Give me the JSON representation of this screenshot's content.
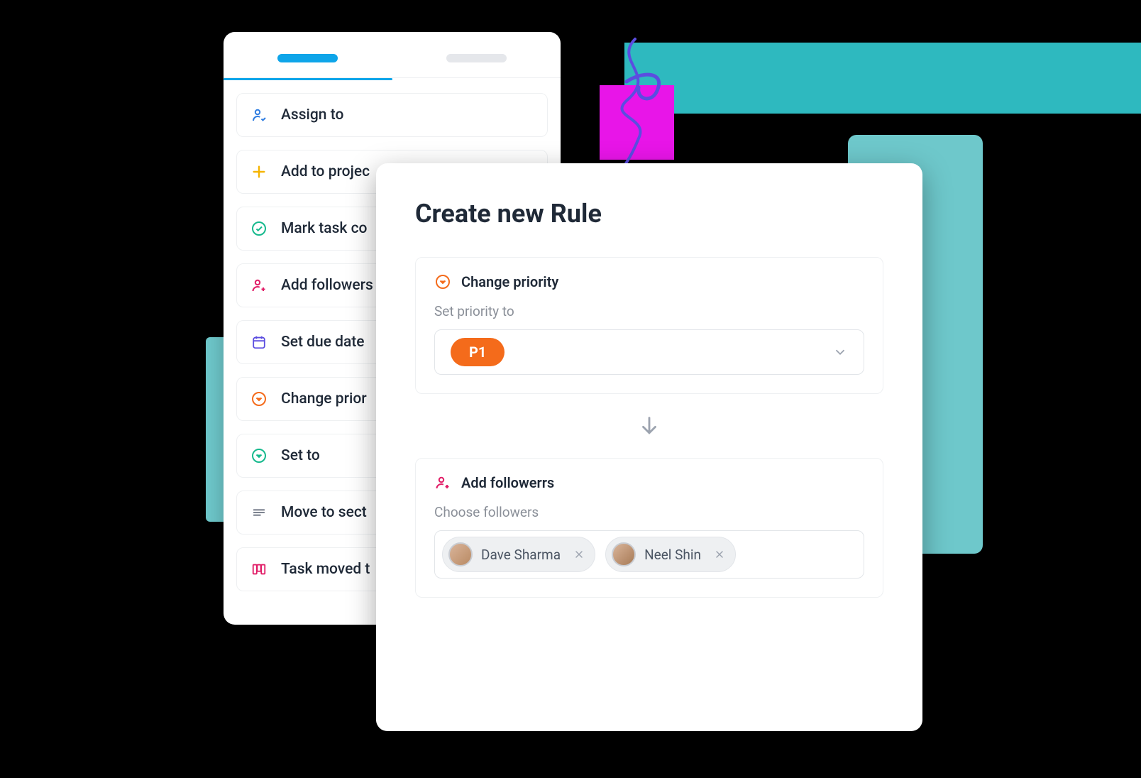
{
  "actions": {
    "items": [
      {
        "label": "Assign to"
      },
      {
        "label": "Add to projec"
      },
      {
        "label": "Mark task co"
      },
      {
        "label": "Add followers"
      },
      {
        "label": "Set due date"
      },
      {
        "label": "Change prior"
      },
      {
        "label": "Set to"
      },
      {
        "label": "Move to sect"
      },
      {
        "label": "Task moved t"
      }
    ]
  },
  "rule": {
    "title": "Create new Rule",
    "priority_block": {
      "title": "Change priority",
      "subtitle": "Set priority to",
      "value": "P1"
    },
    "followers_block": {
      "title": "Add followerrs",
      "subtitle": "Choose followers",
      "chips": [
        {
          "name": "Dave Sharma"
        },
        {
          "name": "Neel Shin"
        }
      ]
    }
  }
}
